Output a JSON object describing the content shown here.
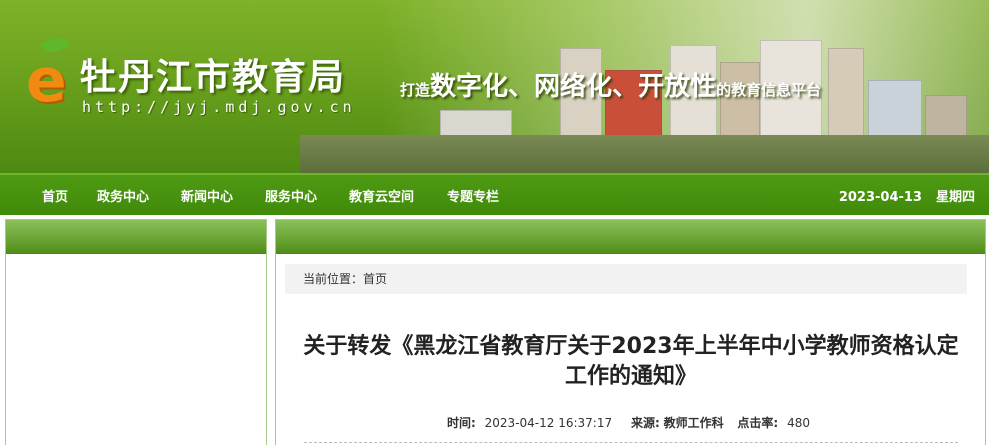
{
  "header": {
    "logo_letter": "e",
    "site_title": "牡丹江市教育局",
    "site_url": "http://jyj.mdj.gov.cn",
    "slogan": {
      "prefix": "打造",
      "word1": "数字化",
      "sep1": "、",
      "word2": "网络化",
      "sep2": "、",
      "word3": "开放性",
      "suffix": "的教育信息平台"
    }
  },
  "nav": {
    "items": [
      "首页",
      "政务中心",
      "新闻中心",
      "服务中心",
      "教育云空间",
      "专题专栏"
    ],
    "date": "2023-04-13",
    "weekday": "星期四"
  },
  "breadcrumb": {
    "label": "当前位置：",
    "home": "首页"
  },
  "article": {
    "title_line1": "关于转发《黑龙江省教育厅关于2023年上半年中小学教师资格认定",
    "title_line2": "工作的通知》",
    "time_label": "时间:",
    "time_value": "2023-04-12 16:37:17",
    "source_label": "来源:",
    "source_value": "教师工作科",
    "clicks_label": "点击率:",
    "clicks_value": "480"
  },
  "colors": {
    "nav_green": "#3f8b0a",
    "banner_green": "#6aa11d",
    "logo_orange": "#f08a10"
  }
}
